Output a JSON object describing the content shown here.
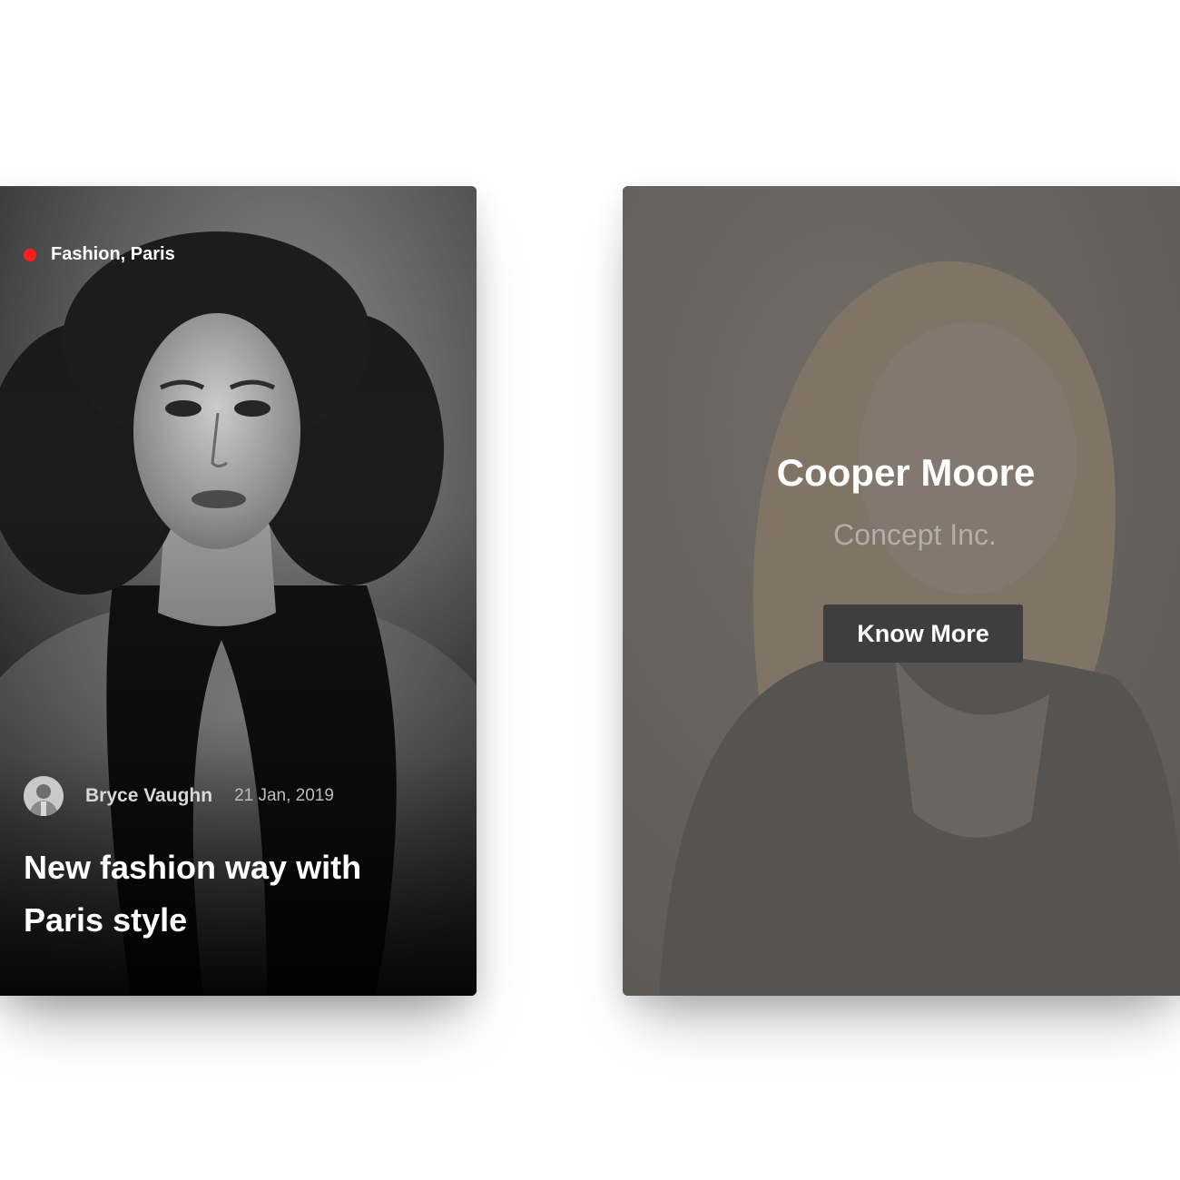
{
  "post_card": {
    "category": "Fashion, Paris",
    "author": "Bryce Vaughn",
    "date": "21 Jan, 2019",
    "title": "New fashion way with Paris style",
    "accent_color": "#ff1e1e",
    "photo": "black-and-white portrait of a woman"
  },
  "profile_card": {
    "name": "Cooper Moore",
    "company": "Concept Inc.",
    "button_label": "Know More",
    "photo": "smiling woman with blonde hair"
  }
}
